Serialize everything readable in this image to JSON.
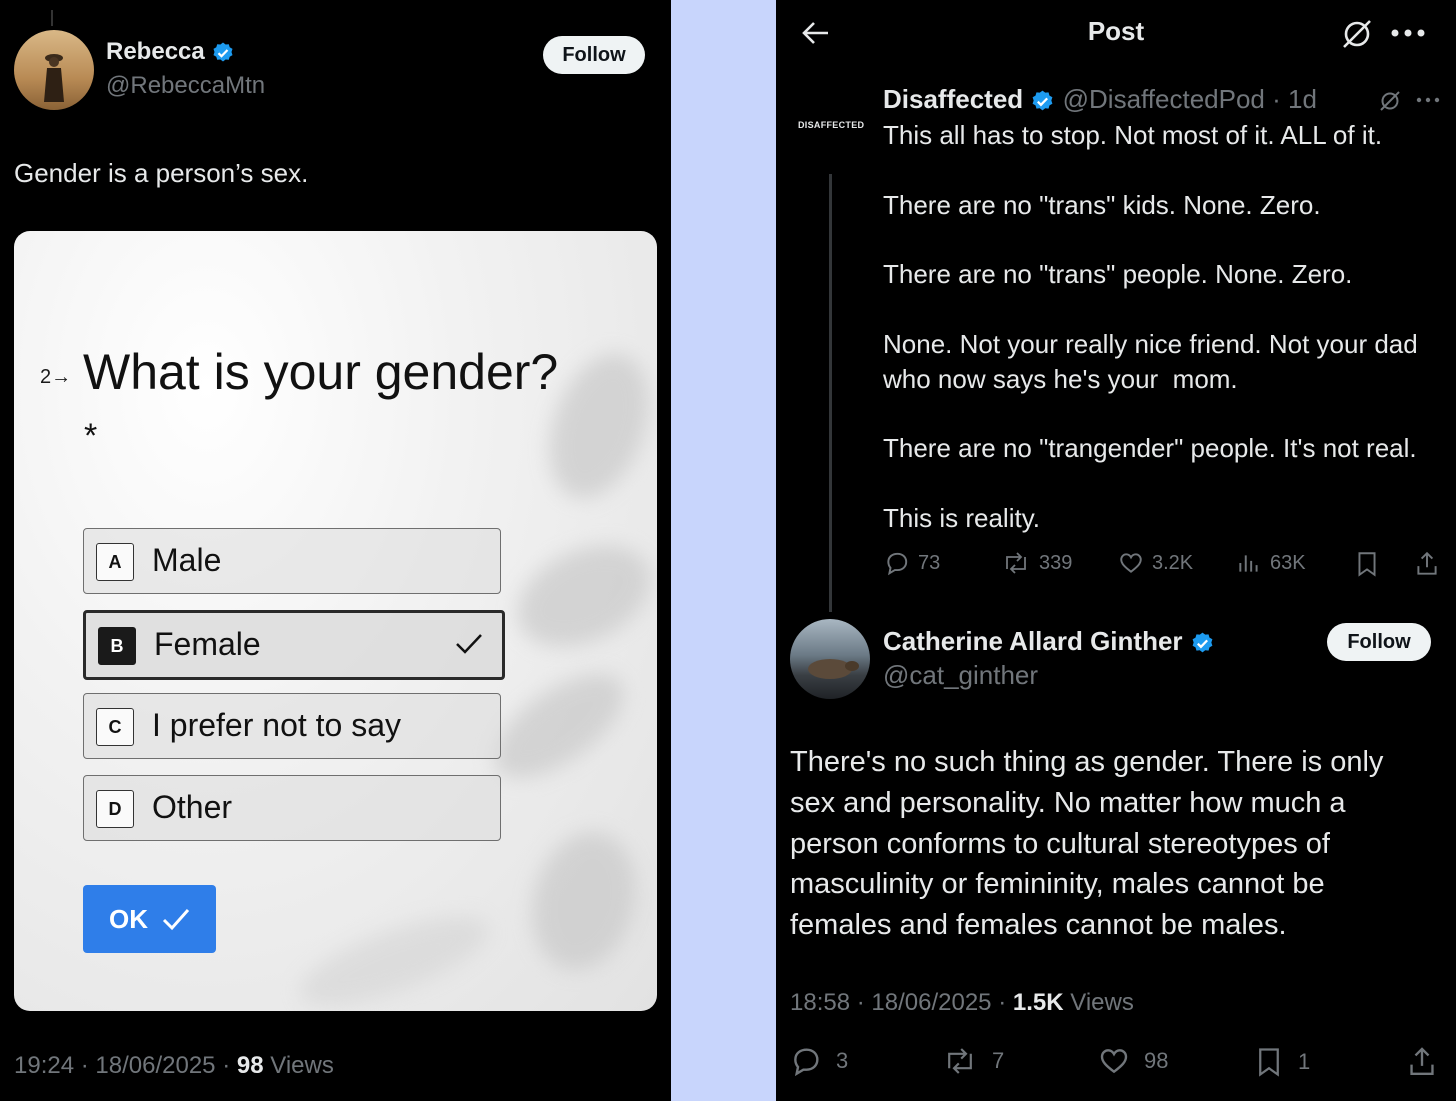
{
  "left_post": {
    "author_name": "Rebecca",
    "author_handle": "@RebeccaMtn",
    "follow_label": "Follow",
    "text": "Gender is a person’s sex.",
    "form": {
      "question_number": "2→",
      "question": "What is your gender?",
      "required_mark": "*",
      "options": [
        {
          "key": "A",
          "label": "Male",
          "selected": false
        },
        {
          "key": "B",
          "label": "Female",
          "selected": true
        },
        {
          "key": "C",
          "label": "I prefer not to say",
          "selected": false
        },
        {
          "key": "D",
          "label": "Other",
          "selected": false
        }
      ],
      "ok_label": "OK"
    },
    "time": "19:24",
    "date": "18/06/2025",
    "views_count": "98",
    "views_label": "Views"
  },
  "right_panel": {
    "header_title": "Post",
    "quoted_post": {
      "author_name": "Disaffected",
      "author_handle": "@DisaffectedPod",
      "age": "· 1d",
      "logo_text": "DISAFFECTED",
      "text": "This all has to stop. Not most of it. ALL of it.\n\nThere are no \"trans\" kids. None. Zero.\n\nThere are no \"trans\" people. None. Zero.\n\nNone. Not your really nice friend. Not your dad who now says he's your  mom.\n\nThere are no \"trangender\" people. It's not real.\n\nThis is reality.",
      "replies": "73",
      "reposts": "339",
      "likes": "3.2K",
      "views": "63K"
    },
    "main_post": {
      "author_name": "Catherine Allard Ginther",
      "author_handle": "@cat_ginther",
      "follow_label": "Follow",
      "text": "There's no such thing as gender. There is only sex and personality. No matter how much a person conforms to cultural stereotypes of masculinity or femininity, males cannot be females and females cannot be males.",
      "time": "18:58",
      "date": "18/06/2025",
      "views_count": "1.5K",
      "views_label": "Views",
      "replies": "3",
      "reposts": "7",
      "likes": "98",
      "bookmarks": "1"
    }
  },
  "colors": {
    "verified_blue": "#1d9bf0",
    "ok_button_blue": "#2f7ee9",
    "divider": "#c8d5fc"
  }
}
